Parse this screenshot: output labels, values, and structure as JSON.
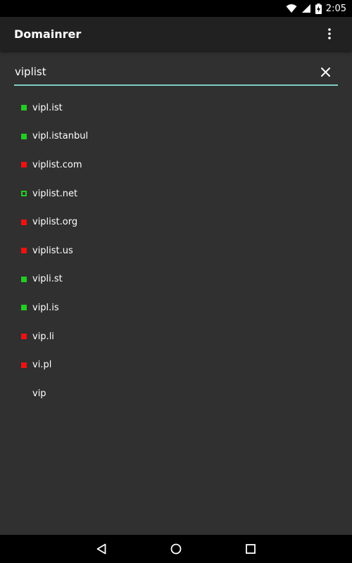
{
  "status_bar": {
    "time": "2:05",
    "icons": [
      "wifi-icon",
      "signal-icon",
      "battery-charging-icon"
    ]
  },
  "app_bar": {
    "title": "Domainrer",
    "overflow_icon": "more-vert-icon"
  },
  "search": {
    "value": "viplist",
    "clear_icon": "close-icon",
    "accent_color": "#80cbc4"
  },
  "colors": {
    "available": "#22cc22",
    "taken": "#ee1111",
    "background": "#303030",
    "app_bar": "#212121"
  },
  "results": [
    {
      "domain": "vipl.ist",
      "status": "available"
    },
    {
      "domain": "vipl.istanbul",
      "status": "available"
    },
    {
      "domain": "viplist.com",
      "status": "taken"
    },
    {
      "domain": "viplist.net",
      "status": "owned"
    },
    {
      "domain": "viplist.org",
      "status": "taken"
    },
    {
      "domain": "viplist.us",
      "status": "taken"
    },
    {
      "domain": "vipli.st",
      "status": "available"
    },
    {
      "domain": "vipl.is",
      "status": "available"
    },
    {
      "domain": "vip.li",
      "status": "taken"
    },
    {
      "domain": "vi.pl",
      "status": "taken"
    },
    {
      "domain": "vip",
      "status": "none"
    }
  ],
  "nav_bar": {
    "buttons": [
      "back-icon",
      "home-icon",
      "recents-icon"
    ]
  }
}
